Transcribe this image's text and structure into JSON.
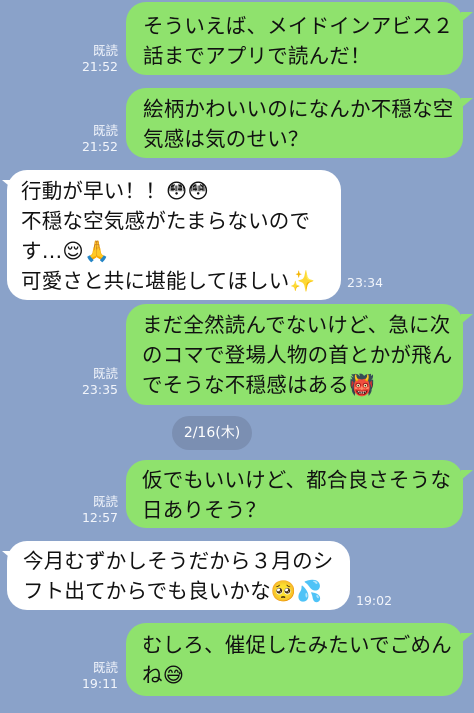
{
  "messages": [
    {
      "lines": [
        "そういえば、メイドインアビス２",
        "話までアプリで読んだ！"
      ],
      "read": "既読",
      "time": "21:52"
    },
    {
      "lines": [
        "絵柄かわいいのになんか不穏な空",
        "気感は気のせい？"
      ],
      "read": "既読",
      "time": "21:52"
    },
    {
      "lines": [
        "行動が早い！！😳😳",
        "不穏な空気感がたまらないので",
        "す…😌🙏",
        "可愛さと共に堪能してほしい✨"
      ],
      "time": "23:34"
    },
    {
      "lines": [
        "まだ全然読んでないけど、急に次",
        "のコマで登場人物の首とかが飛ん",
        "でそうな不穏感はある👹"
      ],
      "read": "既読",
      "time": "23:35"
    },
    {
      "lines": [
        "仮でもいいけど、都合良さそうな",
        "日ありそう？"
      ],
      "read": "既読",
      "time": "12:57"
    },
    {
      "lines": [
        "今月むずかしそうだから３月のシ",
        "フト出てからでも良いかな🥺💦"
      ],
      "time": "19:02"
    },
    {
      "lines": [
        "むしろ、催促したみたいでごめん",
        "ね😅"
      ],
      "read": "既読",
      "time": "19:11"
    }
  ],
  "date_separator": "2/16(木)",
  "colors": {
    "background": "#8aa2c9",
    "outgoing": "#8fe26d",
    "incoming": "#ffffff"
  }
}
